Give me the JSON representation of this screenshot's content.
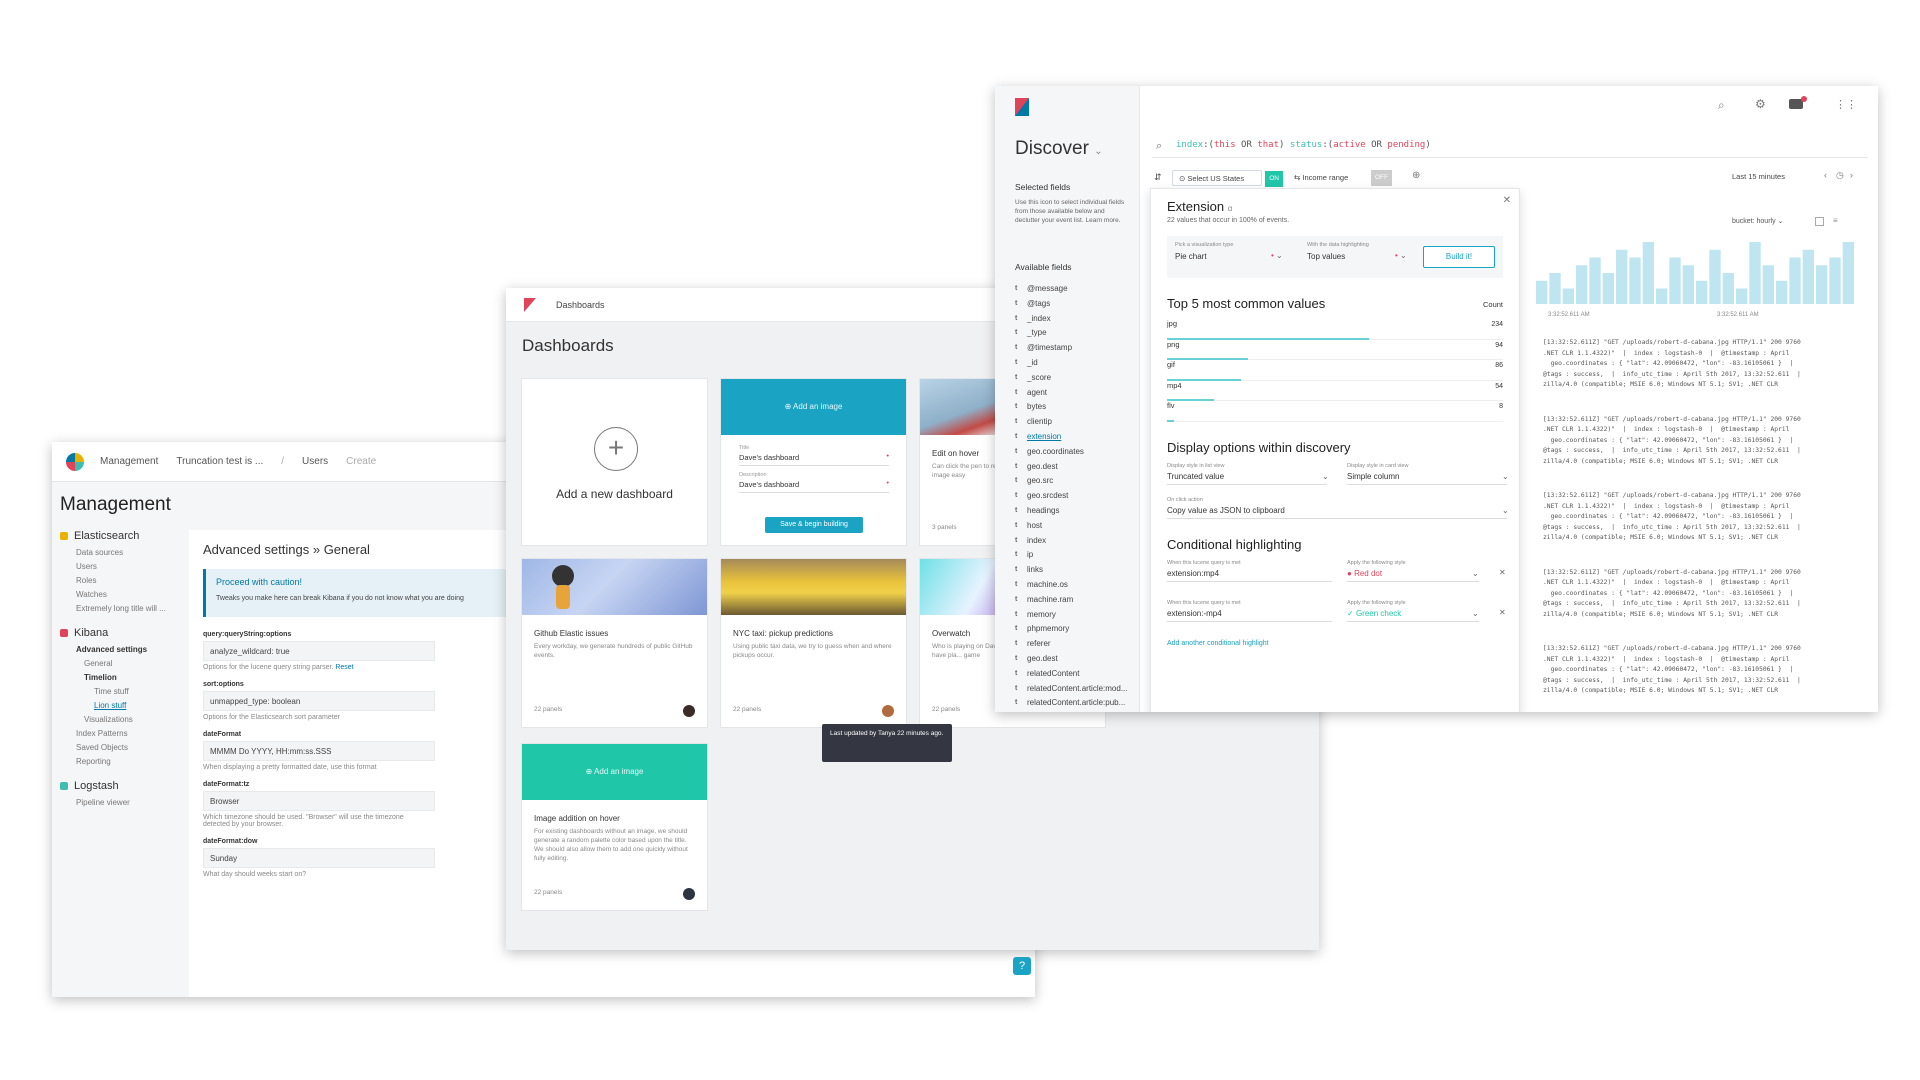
{
  "management": {
    "breadcrumbs": [
      "Management",
      "Truncation test is ...",
      "Users",
      "Create"
    ],
    "title": "Management",
    "nav": [
      {
        "group": "Elasticsearch",
        "color": "#e8b300",
        "items": [
          "Data sources",
          "Users",
          "Roles",
          "Watches",
          "Extremely long title will ..."
        ]
      },
      {
        "group": "Kibana",
        "color": "#e0445a",
        "items": [
          "Advanced settings",
          "General",
          "Timelion",
          "Time stuff",
          "Lion stuff",
          "Visualizations",
          "Index Patterns",
          "Saved Objects",
          "Reporting"
        ]
      },
      {
        "group": "Logstash",
        "color": "#3ebeb0",
        "items": [
          "Pipeline viewer"
        ]
      }
    ],
    "page_title": "Advanced settings » General",
    "caution_title": "Proceed with caution!",
    "caution_text": "Tweaks you make here can break Kibana if you do not know what you are doing",
    "fields": [
      {
        "label": "query:queryString:options",
        "value": "analyze_wildcard: true",
        "hint": "Options for the lucene query string parser.",
        "link": "Reset"
      },
      {
        "label": "sort:options",
        "value": "unmapped_type: boolean",
        "hint": "Options for the Elasticsearch sort parameter",
        "link": ""
      },
      {
        "label": "dateFormat",
        "value": "MMMM Do YYYY, HH:mm:ss.SSS",
        "hint": "When displaying a pretty formatted date, use this format",
        "link": ""
      },
      {
        "label": "dateFormat:tz",
        "value": "Browser",
        "hint": "Which timezone should be used. \"Browser\" will use the timezone detected by your browser.",
        "link": ""
      },
      {
        "label": "dateFormat:dow",
        "value": "Sunday",
        "hint": "What day should weeks start on?",
        "link": ""
      }
    ]
  },
  "dashboards": {
    "breadcrumb": "Dashboards",
    "title": "Dashboards",
    "add_new": "Add a new dashboard",
    "add_image": "Add an image",
    "form": {
      "title_label": "Title",
      "title_value": "Dave's dashboard",
      "desc_label": "Description",
      "desc_value": "Dave's dashboard",
      "save_label": "Save & begin building"
    },
    "hover_card": {
      "title": "Edit on hover",
      "desc": "Can click the pen to re-image easy",
      "panels": "3 panels"
    },
    "cards": [
      {
        "title": "Github Elastic issues",
        "desc": "Every workday, we generate hundreds of public GitHub events.",
        "panels": "22 panels"
      },
      {
        "title": "NYC taxi: pickup predictions",
        "desc": "Using public taxi data, we try to guess when and where pickups occur.",
        "panels": "22 panels"
      },
      {
        "title": "Overwatch",
        "desc": "Who is playing on Dave. I have pla... game",
        "panels": "22 panels"
      },
      {
        "title": "Image addition on hover",
        "desc": "For existing dashboards without an image, we should generate a random palette color based upon the title. We should also allow them to add one quickly without fully editing.",
        "panels": "22 panels"
      }
    ],
    "tooltip": "Last updated by Tanya 22 minutes ago."
  },
  "discover": {
    "title": "Discover",
    "selected_fields": "Selected fields",
    "selected_hint": "Use this icon to select individual fields from those available below and declutter your event list.",
    "learn_more": "Learn more.",
    "available_fields": "Available fields",
    "fields": [
      "@message",
      "@tags",
      "_index",
      "_type",
      "@timestamp",
      "_id",
      "_score",
      "agent",
      "bytes",
      "clientip",
      "extension",
      "geo.coordinates",
      "geo.dest",
      "geo.src",
      "geo.srcdest",
      "headings",
      "host",
      "index",
      "ip",
      "links",
      "machine.os",
      "machine.ram",
      "memory",
      "phpmemory",
      "referer",
      "geo.dest",
      "relatedContent",
      "relatedContent.article:mod...",
      "relatedContent.article:pub..."
    ],
    "query_parts": [
      {
        "t": "index",
        "c": "#3ebeb0"
      },
      {
        "t": ":(",
        "c": "#555"
      },
      {
        "t": "this",
        "c": "#e0445a"
      },
      {
        "t": " OR ",
        "c": "#555"
      },
      {
        "t": "that",
        "c": "#e0445a"
      },
      {
        "t": ") ",
        "c": "#555"
      },
      {
        "t": "status",
        "c": "#3ebeb0"
      },
      {
        "t": ":(",
        "c": "#555"
      },
      {
        "t": "active",
        "c": "#e0445a"
      },
      {
        "t": " OR ",
        "c": "#555"
      },
      {
        "t": "pending",
        "c": "#e0445a"
      },
      {
        "t": ")",
        "c": "#555"
      }
    ],
    "filter1": "Select US States",
    "filter1_state": "ON",
    "filter2": "Income range",
    "filter2_state": "OFF",
    "time_range": "Last 15 minutes",
    "interval": "bucket: hourly",
    "hist_labels": [
      "3:32:52.611 AM",
      "3:32:52.611 AM"
    ],
    "histogram": [
      3,
      4,
      2,
      5,
      6,
      4,
      7,
      6,
      8,
      2,
      6,
      5,
      3,
      7,
      4,
      2,
      8,
      5,
      3,
      6,
      7,
      5,
      6,
      8
    ],
    "popover": {
      "title": "Extension",
      "subtitle": "22 values that occur in 100% of events.",
      "viz_type_label": "Pick a visualization type",
      "viz_type": "Pie chart",
      "highlight_label": "With the data highlighting",
      "highlight": "Top values",
      "build": "Build it!",
      "top_title": "Top 5 most common values",
      "count_label": "Count",
      "values": [
        {
          "name": "jpg",
          "count": 234
        },
        {
          "name": "png",
          "count": 94
        },
        {
          "name": "gif",
          "count": 86
        },
        {
          "name": "mp4",
          "count": 54
        },
        {
          "name": "flv",
          "count": 8
        }
      ],
      "display_title": "Display options within discovery",
      "list_view_label": "Display style in list view",
      "list_view": "Truncated value",
      "card_view_label": "Display style in card view",
      "card_view": "Simple column",
      "click_label": "On click action",
      "click": "Copy value as JSON to clipboard",
      "cond_title": "Conditional highlighting",
      "cond_rules": [
        {
          "when_label": "When this lucene query is met",
          "query": "extension:mp4",
          "style_label": "Apply the following style",
          "style": "Red dot",
          "color": "#e0445a"
        },
        {
          "when_label": "When this lucene query is met",
          "query": "extension:-mp4",
          "style_label": "Apply the following style",
          "style": "Green check",
          "color": "#20c6a8"
        }
      ],
      "add_highlight": "Add another conditional highlight"
    },
    "logs": [
      "[13:32:52.611Z] \"GET /uploads/robert-d-cabana.jpg HTTP/1.1\" 200 9760",
      ".NET CLR 1.1.4322)\"  |  index : logstash-0  |  @timestamp : April",
      "  geo.coordinates : { \"lat\": 42.09060472, \"lon\": -83.16105061 }  |",
      "@tags : success,  |  info_utc_time : April 5th 2017, 13:32:52.611  |",
      "zilla/4.0 (compatible; MSIE 6.0; Windows NT 5.1; SV1; .NET CLR"
    ]
  }
}
